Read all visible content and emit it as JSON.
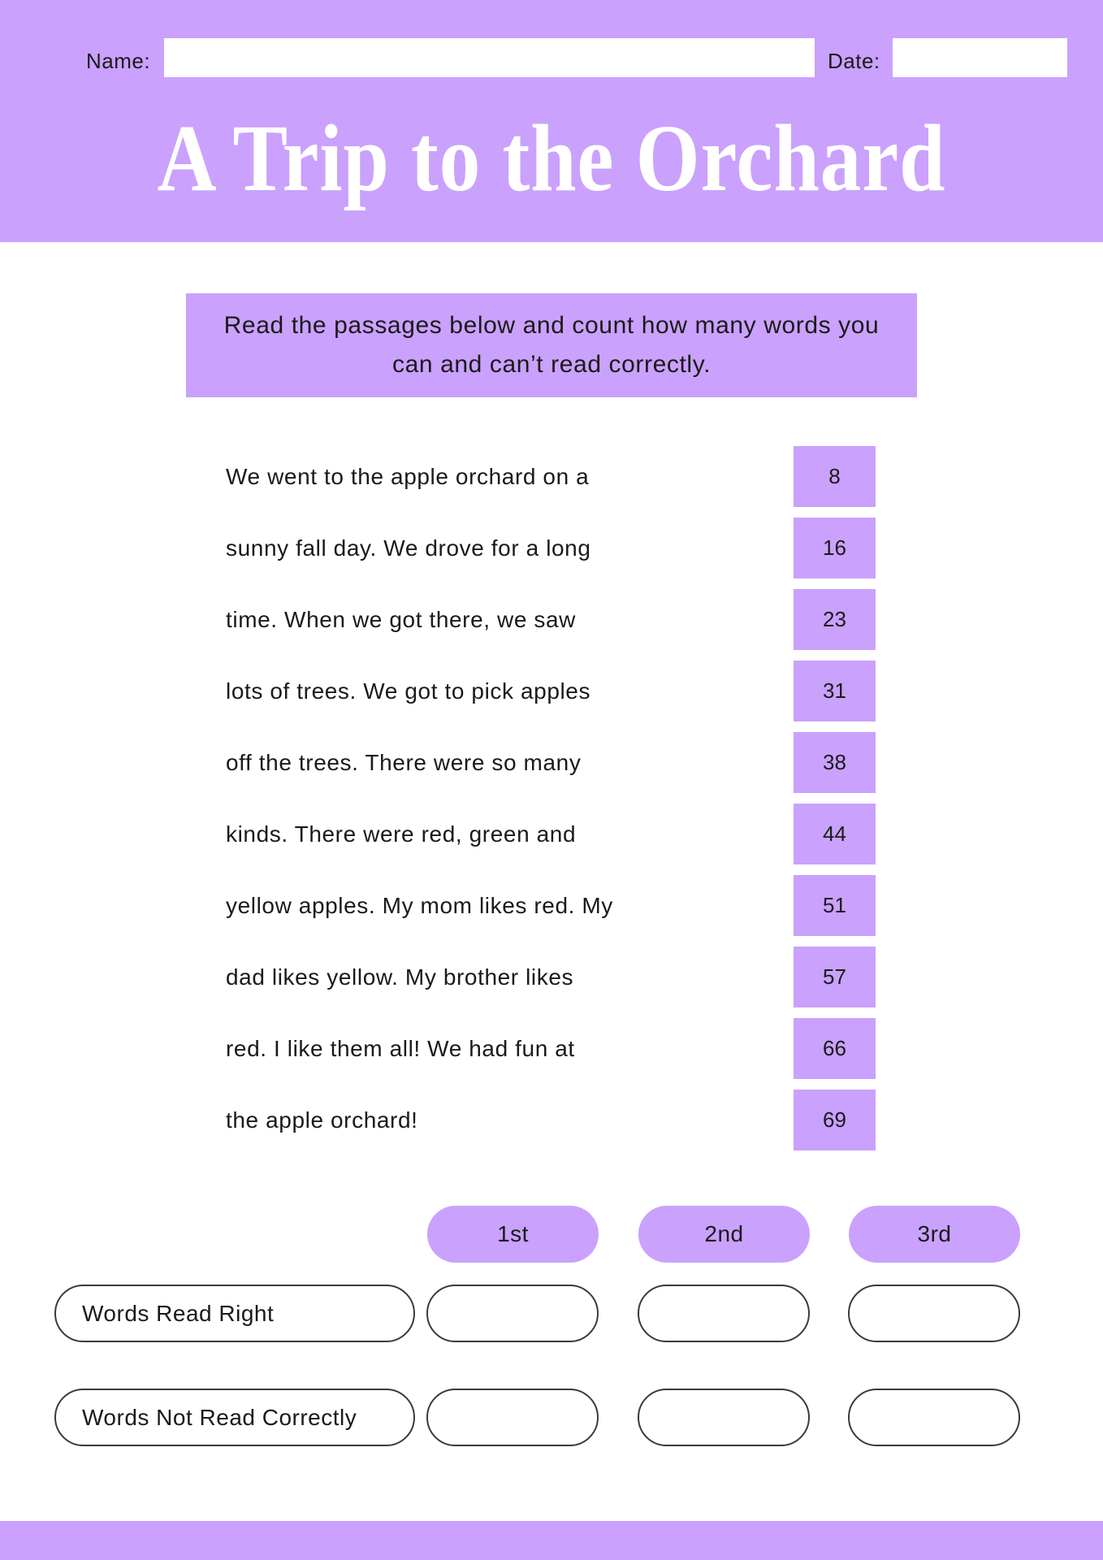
{
  "header": {
    "name_label": "Name:",
    "name_value": "",
    "date_label": "Date:",
    "date_value": "",
    "title": "A Trip to the Orchard"
  },
  "instructions": "Read the passages below and count how many words you can and can’t read correctly.",
  "passage": {
    "lines": [
      {
        "text": "We went to the apple orchard on a",
        "count": "8"
      },
      {
        "text": "sunny fall day. We drove for a long",
        "count": "16"
      },
      {
        "text": "time. When we got there, we saw",
        "count": "23"
      },
      {
        "text": "lots of trees. We got to pick apples",
        "count": "31"
      },
      {
        "text": "off the trees. There were so many",
        "count": "38"
      },
      {
        "text": "kinds. There were red, green and",
        "count": "44"
      },
      {
        "text": "yellow apples. My mom likes red. My",
        "count": "51"
      },
      {
        "text": "dad likes yellow. My brother likes",
        "count": "57"
      },
      {
        "text": "red. I like them all! We had fun at",
        "count": "66"
      },
      {
        "text": "the apple orchard!",
        "count": "69"
      }
    ]
  },
  "score_table": {
    "columns": [
      "1st",
      "2nd",
      "3rd"
    ],
    "rows": [
      {
        "label": "Words Read Right",
        "values": [
          "",
          "",
          ""
        ]
      },
      {
        "label": "Words Not Read Correctly",
        "values": [
          "",
          "",
          ""
        ]
      }
    ]
  },
  "colors": {
    "accent": "#caa1fd",
    "text": "#1a1a1a",
    "outline": "#3a3a3a",
    "background": "#ffffff"
  }
}
